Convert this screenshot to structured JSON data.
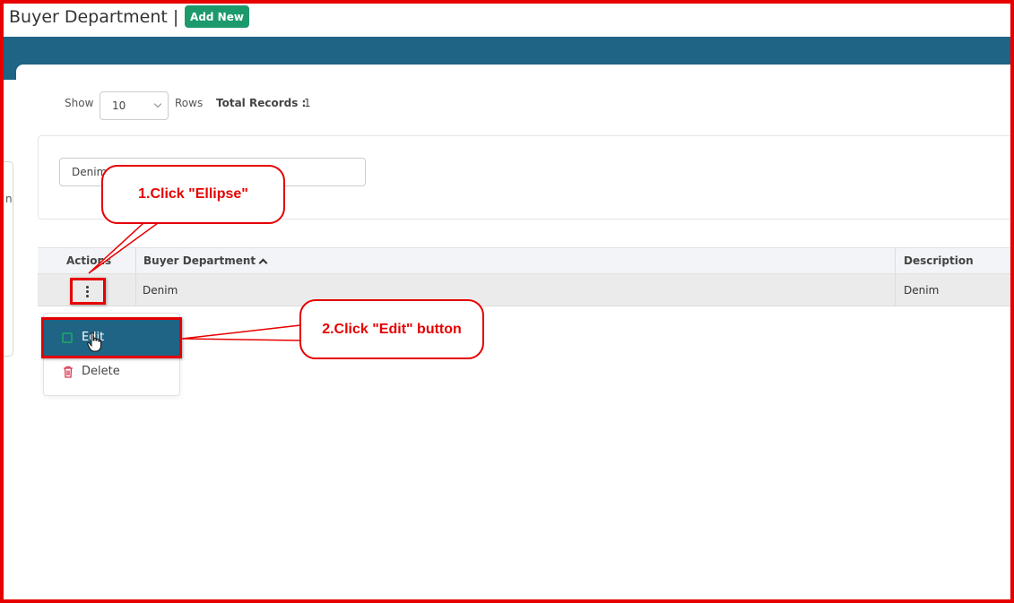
{
  "header": {
    "title": "Buyer Department |",
    "add_new_label": "Add New"
  },
  "toolbar": {
    "show_label": "Show",
    "rows_value": "10",
    "rows_label": "Rows",
    "total_label": "Total Records :",
    "total_value": "1"
  },
  "filter": {
    "value": "Denim"
  },
  "left_tab": {
    "char": "n"
  },
  "table": {
    "columns": [
      "Actions",
      "Buyer Department",
      "Description"
    ],
    "rows": [
      {
        "buyer_department": "Denim",
        "description": "Denim"
      }
    ]
  },
  "action_menu": {
    "edit_label": "Edit",
    "delete_label": "Delete"
  },
  "annotations": {
    "step1": "1.Click \"Ellipse\"",
    "step2": "2.Click \"Edit\" button"
  },
  "colors": {
    "accent_blue": "#1f6385",
    "add_new_green": "#1d9a6c",
    "annotation_red": "#e60000",
    "delete_red": "#d9364f"
  },
  "icons": {
    "sort": "chevron-up-icon",
    "actions": "ellipsis-vertical-icon",
    "edit": "edit-square-icon",
    "delete": "trash-icon",
    "cursor": "hand-pointer-icon"
  }
}
